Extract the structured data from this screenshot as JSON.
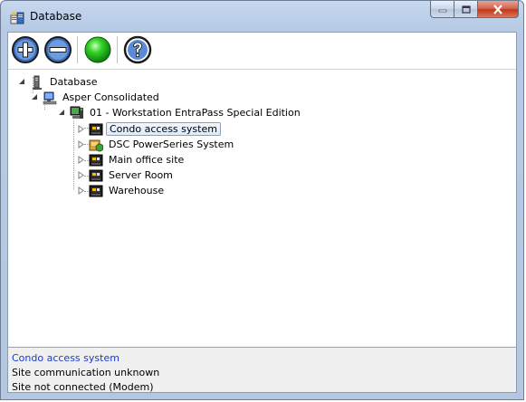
{
  "window": {
    "title": "Database"
  },
  "toolbar": {
    "buttons": [
      {
        "name": "add",
        "icon": "plus-circle-icon"
      },
      {
        "name": "remove",
        "icon": "minus-circle-icon"
      },
      {
        "name": "status",
        "icon": "green-light-icon"
      },
      {
        "name": "help",
        "icon": "question-circle-icon"
      }
    ]
  },
  "tree": {
    "root": {
      "label": "Database",
      "icon": "server-tower-icon"
    },
    "system": {
      "label": "Asper Consolidated",
      "icon": "computer-icon"
    },
    "workstation": {
      "label": "01 - Workstation EntraPass Special Edition",
      "icon": "workstation-icon"
    },
    "sites": [
      {
        "label": "Condo access system",
        "icon": "site-icon",
        "selected": true
      },
      {
        "label": "DSC PowerSeries System",
        "icon": "dsc-site-icon",
        "selected": false
      },
      {
        "label": "Main office site",
        "icon": "site-icon",
        "selected": false
      },
      {
        "label": "Server Room",
        "icon": "site-icon",
        "selected": false
      },
      {
        "label": "Warehouse",
        "icon": "site-icon",
        "selected": false
      }
    ]
  },
  "status_panel": {
    "title": "Condo access system",
    "line1": "Site communication unknown",
    "line2": "Site not connected (Modem)"
  },
  "colors": {
    "selection_text": "#1a3cc8",
    "green_light": "#19c219"
  }
}
